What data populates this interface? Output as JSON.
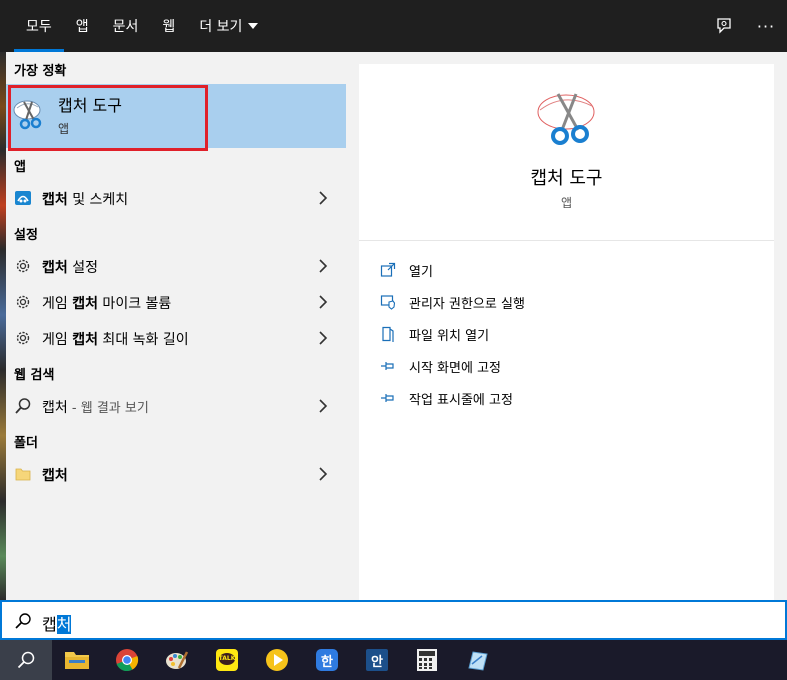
{
  "tabs": [
    {
      "label": "모두",
      "active": true
    },
    {
      "label": "앱",
      "active": false
    },
    {
      "label": "문서",
      "active": false
    },
    {
      "label": "웹",
      "active": false
    },
    {
      "label": "더 보기",
      "active": false
    }
  ],
  "top_icons": [
    "feedback-icon",
    "more-options-icon"
  ],
  "top_more_glyph": "···",
  "best_match": {
    "section_label": "가장 정확",
    "title": "캡처 도구",
    "subtitle": "앱",
    "icon": "snipping-tool-icon"
  },
  "sections": {
    "apps": "앱",
    "settings": "설정",
    "web": "웹 검색",
    "folders": "폴더"
  },
  "results": {
    "apps": [
      {
        "bold": "캡처",
        "rest": " 및 스케치",
        "icon": "snip-sketch-icon"
      }
    ],
    "settings": [
      {
        "pre": "",
        "bold": "캡처",
        "rest": " 설정",
        "icon": "gear-icon"
      },
      {
        "pre": "게임 ",
        "bold": "캡처",
        "rest": " 마이크 볼륨",
        "icon": "gear-icon"
      },
      {
        "pre": "게임 ",
        "bold": "캡처",
        "rest": " 최대 녹화 길이",
        "icon": "gear-icon"
      }
    ],
    "web": [
      {
        "text": "캡처",
        "light": " - 웹 결과 보기",
        "icon": "search-icon"
      }
    ],
    "folders": [
      {
        "bold": "캡처",
        "icon": "folder-icon"
      }
    ]
  },
  "preview": {
    "title": "캡처 도구",
    "subtitle": "앱",
    "actions": [
      {
        "label": "열기",
        "icon": "open-icon"
      },
      {
        "label": "관리자 권한으로 실행",
        "icon": "run-as-admin-icon"
      },
      {
        "label": "파일 위치 열기",
        "icon": "file-location-icon"
      },
      {
        "label": "시작 화면에 고정",
        "icon": "pin-icon"
      },
      {
        "label": "작업 표시줄에 고정",
        "icon": "pin-icon"
      }
    ]
  },
  "search": {
    "value_plain": "캡",
    "value_selected": "처"
  },
  "taskbar": {
    "apps": [
      {
        "name": "file-explorer-icon",
        "running": false
      },
      {
        "name": "chrome-icon",
        "running": false
      },
      {
        "name": "paint-icon",
        "running": false
      },
      {
        "name": "kakaotalk-icon",
        "running": false,
        "text": "TALK"
      },
      {
        "name": "media-player-icon",
        "running": false
      },
      {
        "name": "hangul-icon",
        "running": false,
        "text": "한"
      },
      {
        "name": "hangul-alt-icon",
        "running": false,
        "text": "안"
      },
      {
        "name": "calculator-icon",
        "running": false
      },
      {
        "name": "snipping-tool-taskbar-icon",
        "running": false
      }
    ]
  },
  "colors": {
    "accent": "#0078d7",
    "highlight": "#a9cfee",
    "outline": "#e0202a"
  }
}
